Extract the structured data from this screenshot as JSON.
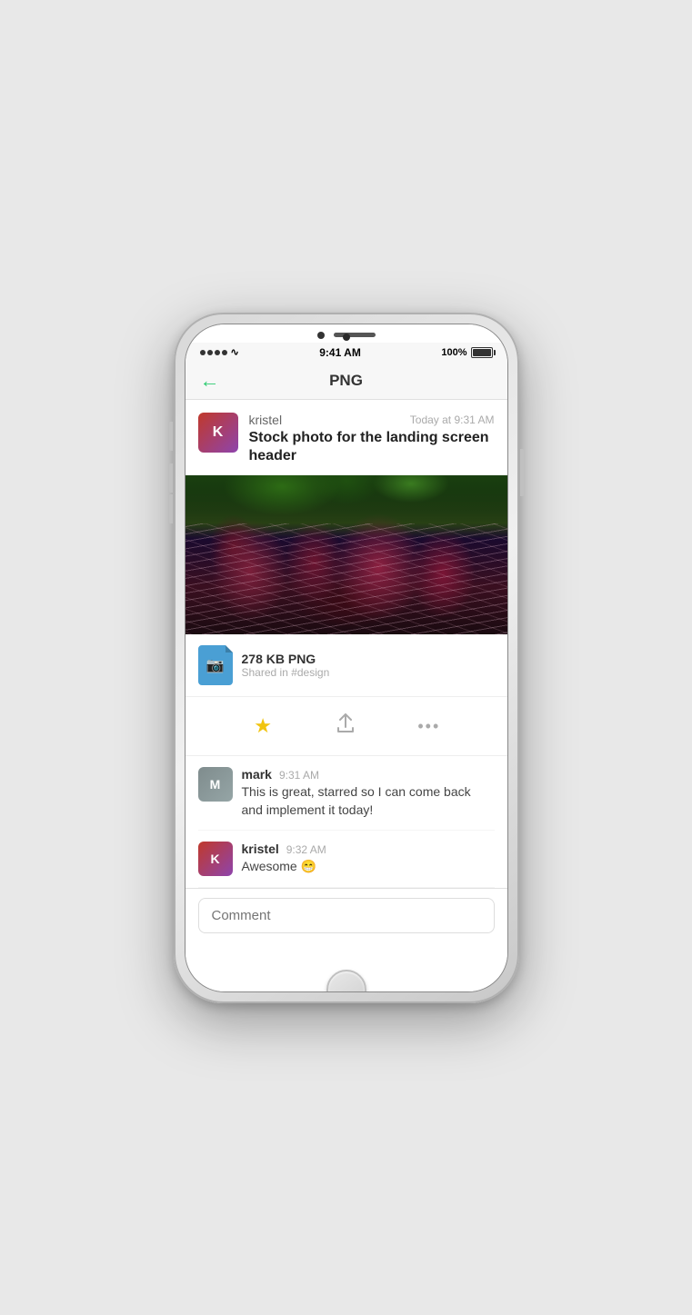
{
  "status_bar": {
    "time": "9:41 AM",
    "battery": "100%",
    "signal_dots": 4
  },
  "nav": {
    "back_label": "←",
    "title": "PNG"
  },
  "post": {
    "author": "kristel",
    "timestamp": "Today at 9:31 AM",
    "message": "Stock photo for the landing screen header",
    "file": {
      "size_label": "278 KB PNG",
      "channel": "Shared in #design"
    }
  },
  "actions": {
    "star_label": "★",
    "share_label": "↑",
    "more_label": "•••"
  },
  "comments": [
    {
      "author": "mark",
      "time": "9:31 AM",
      "text": "This is great, starred so I can come back and implement it today!"
    },
    {
      "author": "kristel",
      "time": "9:32 AM",
      "text": "Awesome 😁"
    }
  ],
  "comment_input": {
    "placeholder": "Comment"
  }
}
